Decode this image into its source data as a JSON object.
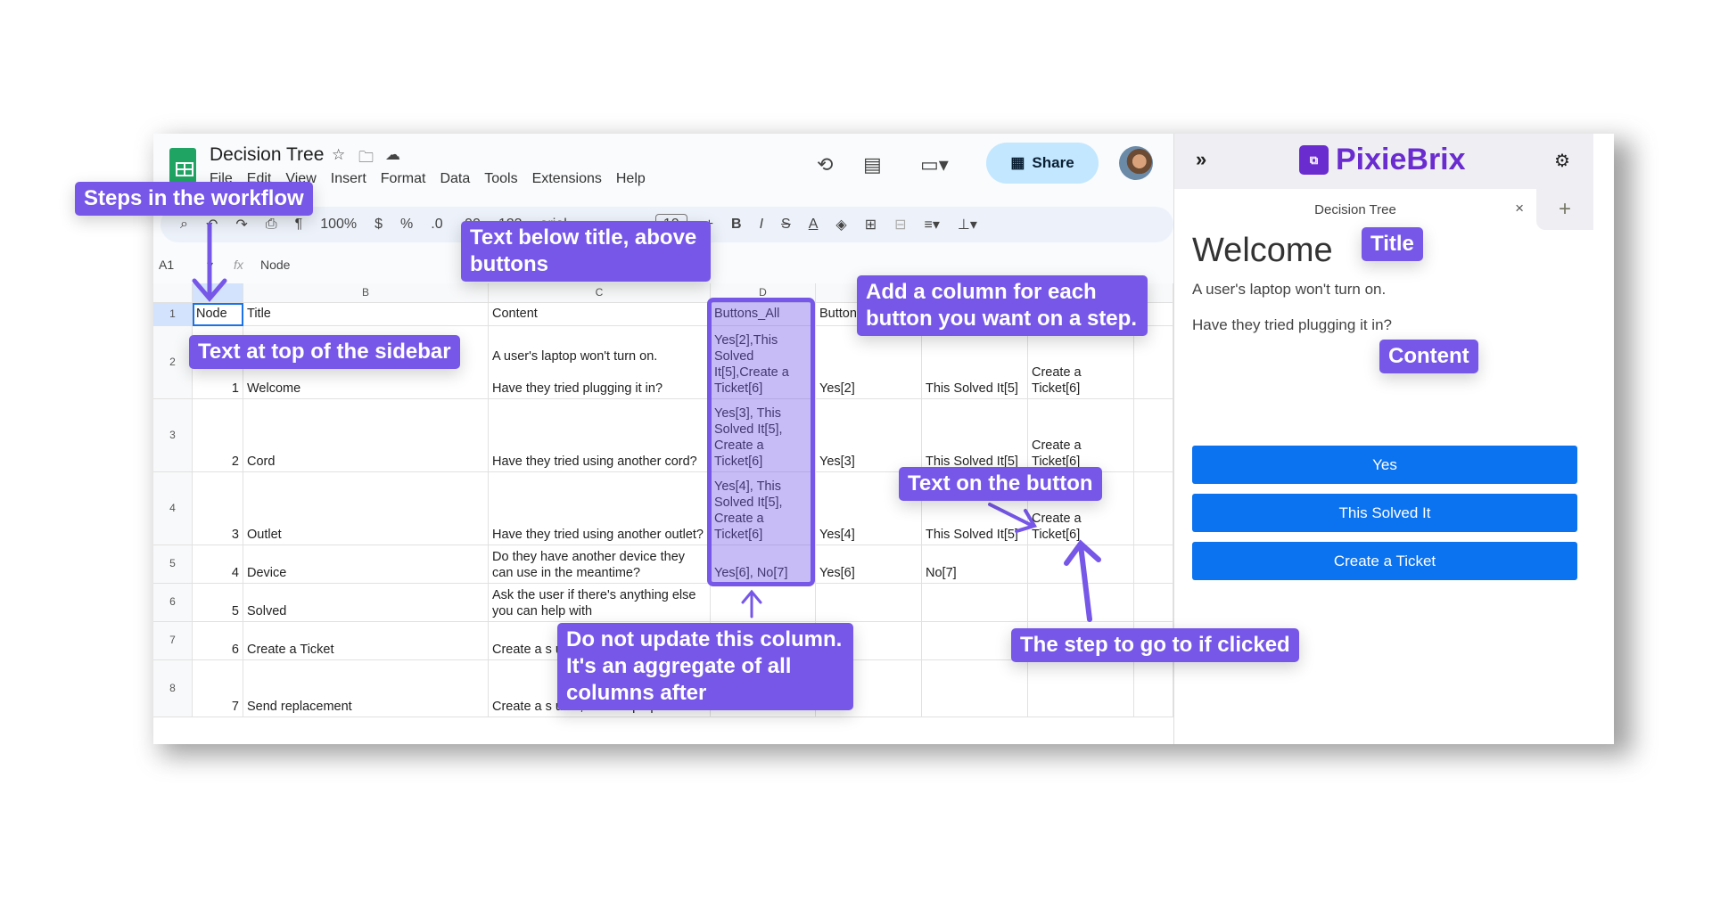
{
  "sheets": {
    "doc_title": "Decision Tree",
    "menu": [
      "File",
      "Edit",
      "View",
      "Insert",
      "Format",
      "Data",
      "Tools",
      "Extensions",
      "Help"
    ],
    "share_label": "Share",
    "toolbar": {
      "zoom": "100%",
      "currency": "$",
      "percent": "%",
      "dec_less": ".0",
      "dec_more": ".00",
      "format_123": "123",
      "font": "arial",
      "font_size": "10",
      "bold": "B",
      "italic": "I",
      "strike": "S",
      "text_color": "A"
    },
    "name_box": "A1",
    "formula": "Node",
    "columns": [
      "",
      "B",
      "C",
      "D",
      "",
      "",
      "",
      ""
    ],
    "rows": [
      {
        "n": "1",
        "cells": [
          "Node",
          "Title",
          "Content",
          "Buttons_All",
          "Button",
          "",
          "",
          ""
        ]
      },
      {
        "n": "2",
        "cells": [
          "1",
          "Welcome",
          "A user's laptop won't turn on.\n\nHave they tried plugging it in?",
          "Yes[2],This Solved It[5],Create a Ticket[6]",
          "Yes[2]",
          "This Solved It[5]",
          "Create a Ticket[6]",
          ""
        ]
      },
      {
        "n": "3",
        "cells": [
          "2",
          "Cord",
          "Have they tried using another cord?",
          "Yes[3], This Solved It[5], Create a Ticket[6]",
          "Yes[3]",
          "This Solved It[5]",
          "Create a Ticket[6]",
          ""
        ]
      },
      {
        "n": "4",
        "cells": [
          "3",
          "Outlet",
          "Have they tried using another outlet?",
          "Yes[4], This Solved It[5], Create a Ticket[6]",
          "Yes[4]",
          "This Solved It[5]",
          "Create a Ticket[6]",
          ""
        ]
      },
      {
        "n": "5",
        "cells": [
          "4",
          "Device",
          "Do they have another device they can use in the meantime?",
          "Yes[6], No[7]",
          "Yes[6]",
          "No[7]",
          "",
          ""
        ]
      },
      {
        "n": "6",
        "cells": [
          "5",
          "Solved",
          "Ask the user if there's anything else you can help with",
          "",
          "",
          "",
          "",
          ""
        ]
      },
      {
        "n": "7",
        "cells": [
          "6",
          "Create a Ticket",
          "Create a s user",
          "",
          "",
          "",
          "",
          ""
        ]
      },
      {
        "n": "8",
        "cells": [
          "7",
          "Send replacement",
          "Create a s user, and s laptop",
          "",
          "",
          "",
          "",
          ""
        ]
      }
    ]
  },
  "sidebar": {
    "brand": "PixieBrix",
    "tab_label": "Decision Tree",
    "title": "Welcome",
    "content": [
      "A user's laptop won't turn on.",
      "Have they tried plugging it in?"
    ],
    "buttons": [
      "Yes",
      "This Solved It",
      "Create a Ticket"
    ],
    "button_color": "#0b72f0"
  },
  "annotations": {
    "steps": "Steps in the workflow",
    "below_title": "Text below title, above buttons",
    "top_sidebar": "Text at top of the sidebar",
    "add_column": "Add a column for each button you want on a step.",
    "text_on_button": "Text on the button",
    "step_go": "The step to go to if clicked",
    "do_not_update": "Do not update this column. It's an aggregate of all columns after",
    "title_badge": "Title",
    "content_badge": "Content",
    "color": "#7657e8"
  }
}
